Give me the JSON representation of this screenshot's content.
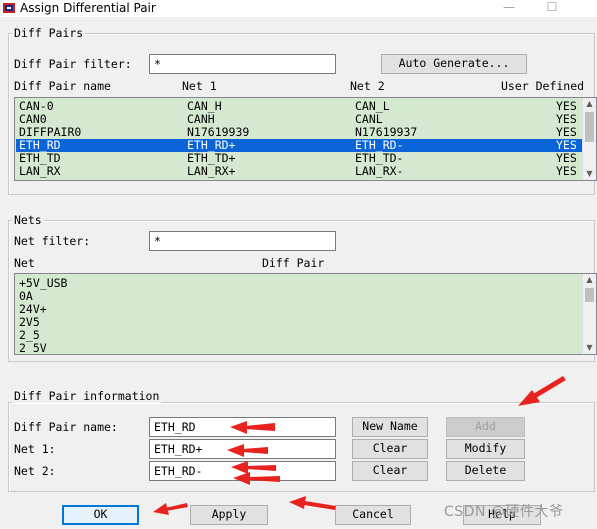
{
  "window": {
    "title": "Assign Differential Pair",
    "minimize_glyph": "—",
    "maximize_glyph": "☐"
  },
  "diff_pairs": {
    "group_title": "Diff Pairs",
    "filter_label": "Diff Pair filter:",
    "filter_value": "*",
    "auto_generate_label": "Auto Generate...",
    "columns": [
      "Diff Pair name",
      "Net 1",
      "Net 2",
      "User Defined"
    ],
    "rows": [
      {
        "name": "CAN-0",
        "net1": "CAN_H",
        "net2": "CAN_L",
        "user": "YES"
      },
      {
        "name": "CAN0",
        "net1": "CANH",
        "net2": "CANL",
        "user": "YES"
      },
      {
        "name": "DIFFPAIR0",
        "net1": "N17619939",
        "net2": "N17619937",
        "user": "YES"
      },
      {
        "name": "ETH_RD",
        "net1": "ETH_RD+",
        "net2": "ETH_RD-",
        "user": "YES"
      },
      {
        "name": "ETH_TD",
        "net1": "ETH_TD+",
        "net2": "ETH_TD-",
        "user": "YES"
      },
      {
        "name": "LAN_RX",
        "net1": "LAN_RX+",
        "net2": "LAN_RX-",
        "user": "YES"
      }
    ],
    "selected_row": 3
  },
  "nets": {
    "group_title": "Nets",
    "filter_label": "Net filter:",
    "filter_value": "*",
    "columns": [
      "Net",
      "Diff Pair"
    ],
    "rows": [
      "+5V_USB",
      "0A",
      "24V+",
      "2V5",
      "2_5",
      "2_5V"
    ]
  },
  "info": {
    "group_title": "Diff Pair information",
    "name_label": "Diff Pair name:",
    "name_value": "ETH_RD",
    "net1_label": "Net 1:",
    "net1_value": "ETH_RD+",
    "net2_label": "Net 2:",
    "net2_value": "ETH_RD-",
    "new_name_label": "New Name",
    "clear1_label": "Clear",
    "clear2_label": "Clear",
    "add_label": "Add",
    "modify_label": "Modify",
    "delete_label": "Delete"
  },
  "footer": {
    "ok_label": "OK",
    "apply_label": "Apply",
    "cancel_label": "Cancel",
    "help_label": "Help"
  },
  "watermark": "CSDN @硬件大爷",
  "colors": {
    "annotation_arrow": "#e8231f",
    "list_background": "#d4e9d0",
    "selection": "#0a64d8"
  }
}
